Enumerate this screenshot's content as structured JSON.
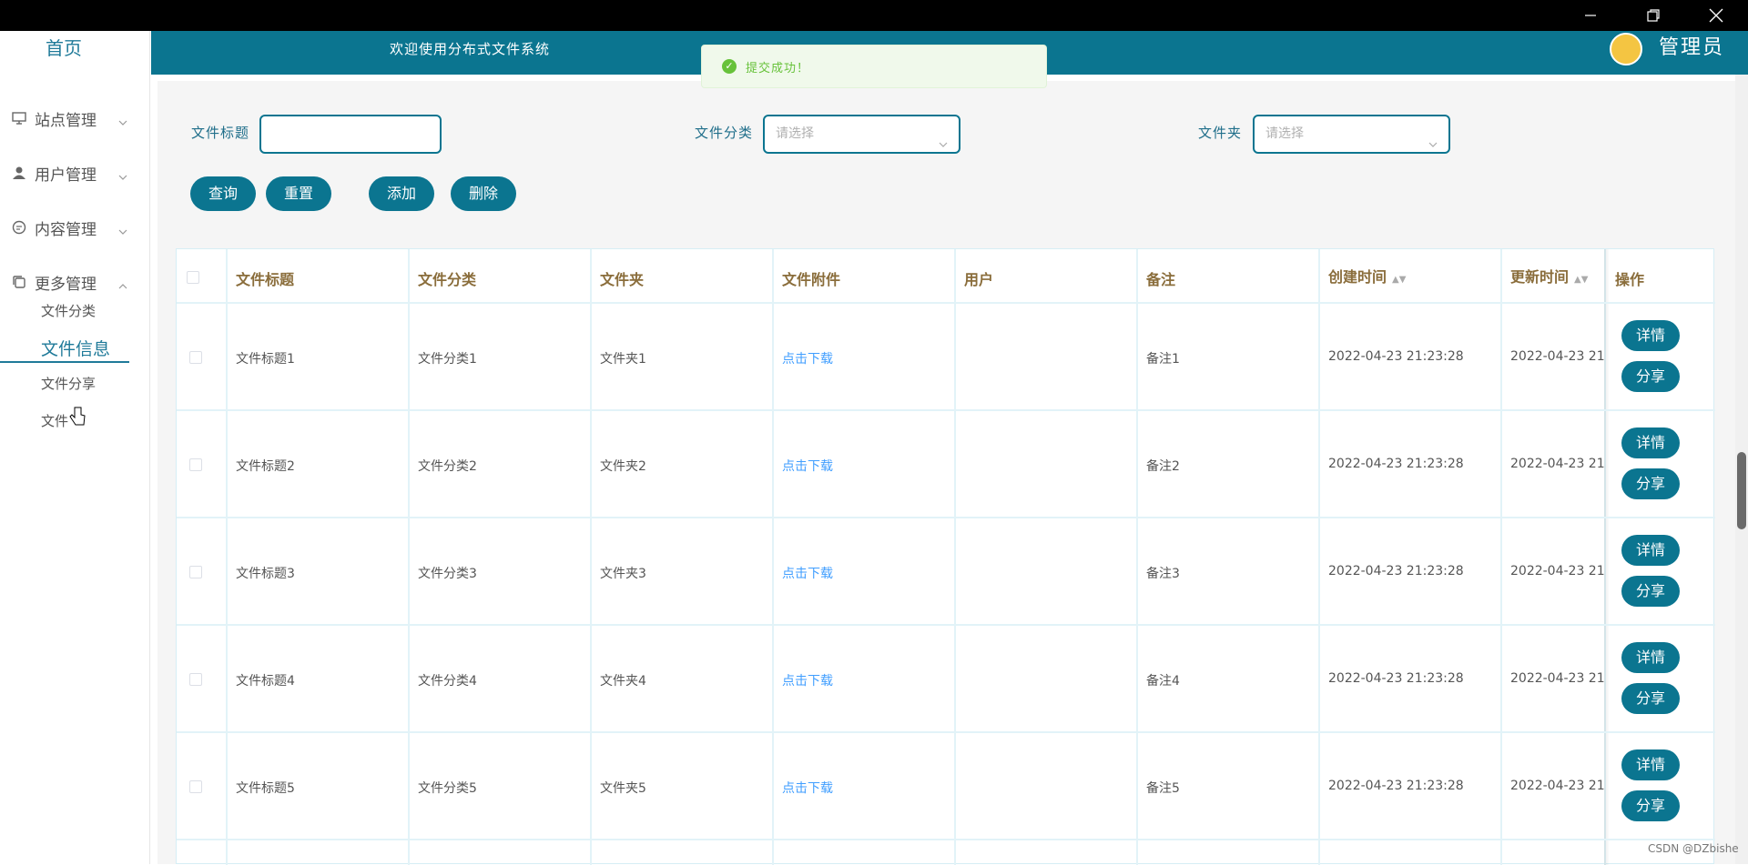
{
  "window": {
    "minimize_icon": "minimize-icon",
    "restore_icon": "restore-icon",
    "close_icon": "close-icon"
  },
  "sidebar": {
    "home": "首页",
    "menus": [
      {
        "label": "站点管理",
        "icon": "monitor-icon"
      },
      {
        "label": "用户管理",
        "icon": "user-icon"
      },
      {
        "label": "内容管理",
        "icon": "chat-icon"
      },
      {
        "label": "更多管理",
        "icon": "copy-icon"
      }
    ],
    "sub_items": [
      "文件分类",
      "文件信息",
      "文件分享",
      "文件"
    ]
  },
  "header": {
    "welcome": "欢迎使用分布式文件系统",
    "admin": "管理员"
  },
  "toast": {
    "message": "提交成功！"
  },
  "filters": {
    "title_label": "文件标题",
    "category_label": "文件分类",
    "category_placeholder": "请选择",
    "folder_label": "文件夹",
    "folder_placeholder": "请选择"
  },
  "buttons": {
    "query": "查询",
    "reset": "重置",
    "add": "添加",
    "delete": "删除"
  },
  "table": {
    "headers": [
      "文件标题",
      "文件分类",
      "文件夹",
      "文件附件",
      "用户",
      "备注",
      "创建时间",
      "更新时间",
      "操作"
    ],
    "rows": [
      {
        "title": "文件标题1",
        "category": "文件分类1",
        "folder": "文件夹1",
        "attachment": "点击下载",
        "user": "",
        "note": "备注1",
        "created": "2022-04-23 21:23:28",
        "updated": "2022-04-23 21"
      },
      {
        "title": "文件标题2",
        "category": "文件分类2",
        "folder": "文件夹2",
        "attachment": "点击下载",
        "user": "",
        "note": "备注2",
        "created": "2022-04-23 21:23:28",
        "updated": "2022-04-23 21"
      },
      {
        "title": "文件标题3",
        "category": "文件分类3",
        "folder": "文件夹3",
        "attachment": "点击下载",
        "user": "",
        "note": "备注3",
        "created": "2022-04-23 21:23:28",
        "updated": "2022-04-23 21"
      },
      {
        "title": "文件标题4",
        "category": "文件分类4",
        "folder": "文件夹4",
        "attachment": "点击下载",
        "user": "",
        "note": "备注4",
        "created": "2022-04-23 21:23:28",
        "updated": "2022-04-23 21"
      },
      {
        "title": "文件标题5",
        "category": "文件分类5",
        "folder": "文件夹5",
        "attachment": "点击下载",
        "user": "",
        "note": "备注5",
        "created": "2022-04-23 21:23:28",
        "updated": "2022-04-23 21"
      }
    ],
    "detail_label": "详情",
    "share_label": "分享"
  },
  "watermark": "CSDN @DZbishe",
  "colors": {
    "primary": "#0b7590",
    "accent": "#1f7a99",
    "link": "#409eff",
    "success": "#67c23a"
  }
}
